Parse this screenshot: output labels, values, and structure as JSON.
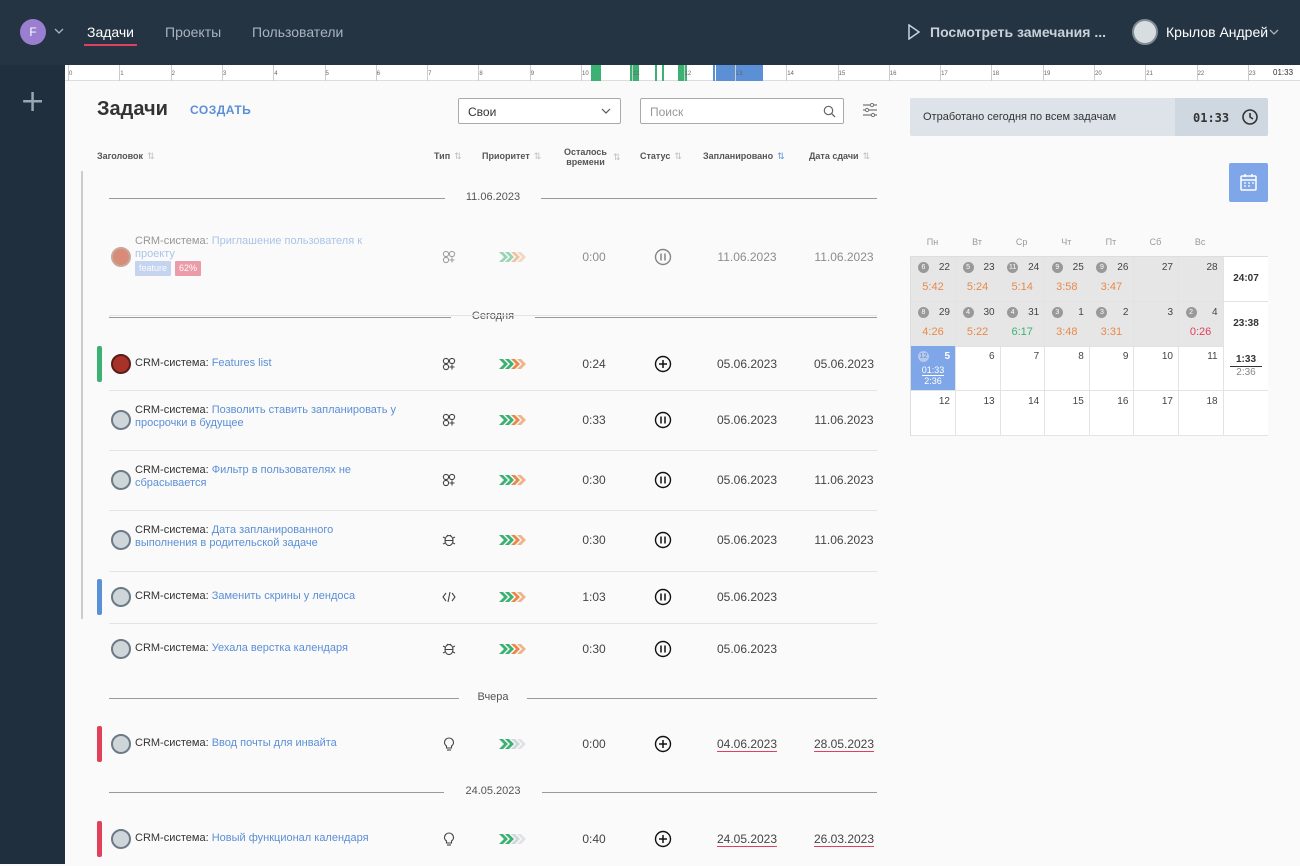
{
  "header": {
    "avatar_letter": "F",
    "nav": [
      "Задачи",
      "Проекты",
      "Пользователи"
    ],
    "remarks": "Посмотреть замечания ...",
    "user_name": "Крылов Андрей"
  },
  "timeline": {
    "hours": [
      "0",
      "1",
      "2",
      "3",
      "4",
      "5",
      "6",
      "7",
      "8",
      "9",
      "10",
      "11",
      "12",
      "13",
      "14",
      "15",
      "16",
      "17",
      "18",
      "19",
      "20",
      "21",
      "22",
      "23"
    ],
    "current": "01:33"
  },
  "page": {
    "title": "Задачи",
    "create": "СОЗДАТЬ",
    "filter_value": "Свои",
    "search_placeholder": "Поиск"
  },
  "columns": {
    "title": "Заголовок",
    "type": "Тип",
    "priority": "Приоритет",
    "left1": "Осталось",
    "left2": "времени",
    "status": "Статус",
    "planned": "Запланировано",
    "due": "Дата сдачи"
  },
  "groups": [
    "11.06.2023",
    "Сегодня",
    "Вчера",
    "24.05.2023"
  ],
  "tasks": [
    {
      "project": "CRM-система:",
      "title1": "Приглашение пользователя к",
      "title2": "проекту",
      "tag": "feature",
      "percent": "62%",
      "left": "0:00",
      "planned": "11.06.2023",
      "due": "11.06.2023"
    },
    {
      "project": "CRM-система:",
      "title1": "Features list",
      "title2": "",
      "left": "0:24",
      "planned": "05.06.2023",
      "due": "05.06.2023"
    },
    {
      "project": "CRM-система:",
      "title1": "Позволить ставить запланировать у",
      "title2": "просрочки в будущее",
      "left": "0:33",
      "planned": "05.06.2023",
      "due": "11.06.2023"
    },
    {
      "project": "CRM-система:",
      "title1": "Фильтр в пользователях не",
      "title2": "сбрасывается",
      "left": "0:30",
      "planned": "05.06.2023",
      "due": "11.06.2023"
    },
    {
      "project": "CRM-система:",
      "title1": "Дата запланированного",
      "title2": "выполнения в родительской задаче",
      "left": "0:30",
      "planned": "05.06.2023",
      "due": "11.06.2023"
    },
    {
      "project": "CRM-система:",
      "title1": "Заменить скрины у лендоса",
      "title2": "",
      "left": "1:03",
      "planned": "05.06.2023",
      "due": ""
    },
    {
      "project": "CRM-система:",
      "title1": "Уехала верстка календаря",
      "title2": "",
      "left": "0:30",
      "planned": "05.06.2023",
      "due": ""
    },
    {
      "project": "CRM-система:",
      "title1": "Ввод почты для инвайта",
      "title2": "",
      "left": "0:00",
      "planned": "04.06.2023",
      "due": "28.05.2023"
    },
    {
      "project": "CRM-система:",
      "title1": "Новый функционал календаря",
      "title2": "",
      "left": "0:40",
      "planned": "24.05.2023",
      "due": "26.03.2023"
    }
  ],
  "right": {
    "worked_label": "Отработано сегодня по всем задачам",
    "worked_time": "01:33",
    "dow": [
      "Пн",
      "Вт",
      "Ср",
      "Чт",
      "Пт",
      "Сб",
      "Вс"
    ],
    "week1": [
      [
        "6",
        "22",
        "5:42"
      ],
      [
        "5",
        "23",
        "5:24"
      ],
      [
        "11",
        "24",
        "5:14"
      ],
      [
        "9",
        "25",
        "3:58"
      ],
      [
        "9",
        "26",
        "3:47"
      ],
      [
        "",
        "27",
        ""
      ],
      [
        "",
        "28",
        ""
      ]
    ],
    "week1_total": "24:07",
    "week2": [
      [
        "8",
        "29",
        "4:26"
      ],
      [
        "4",
        "30",
        "5:22"
      ],
      [
        "4",
        "31",
        "6:17"
      ],
      [
        "3",
        "1",
        "3:48"
      ],
      [
        "3",
        "2",
        "3:31"
      ],
      [
        "",
        "3",
        ""
      ],
      [
        "2",
        "4",
        "0:26"
      ]
    ],
    "week2_total": "23:38",
    "week3": [
      [
        "12",
        "5",
        ""
      ],
      [
        "",
        "6",
        ""
      ],
      [
        "",
        "7",
        ""
      ],
      [
        "",
        "8",
        ""
      ],
      [
        "",
        "9",
        ""
      ],
      [
        "",
        "10",
        ""
      ],
      [
        "",
        "11",
        ""
      ]
    ],
    "today_worked": "01:33",
    "today_planned": "2:36",
    "week3_total": "1:33",
    "week3_planned": "2:36",
    "week4": [
      [
        "",
        "12",
        ""
      ],
      [
        "",
        "13",
        ""
      ],
      [
        "",
        "14",
        ""
      ],
      [
        "",
        "15",
        ""
      ],
      [
        "",
        "16",
        ""
      ],
      [
        "",
        "17",
        ""
      ],
      [
        "",
        "18",
        ""
      ]
    ],
    "colors": {
      "orange": "#e8894a",
      "green": "#3bb273",
      "red": "#e0405a",
      "accent": "#5b8fd6"
    }
  }
}
